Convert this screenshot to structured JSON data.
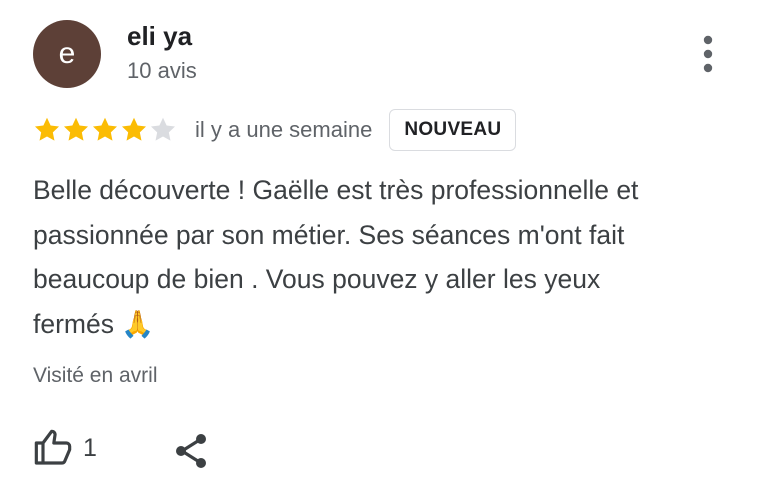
{
  "reviewer": {
    "avatar_letter": "e",
    "name": "eli ya",
    "review_count": "10 avis"
  },
  "rating": {
    "value": 4,
    "max": 5
  },
  "date": "il y a une semaine",
  "badge": "NOUVEAU",
  "review": {
    "line1": "Belle découverte ! Gaëlle est très professionnelle et",
    "line2": "passionnée par son métier. Ses séances m'ont fait",
    "line3": "beaucoup de bien . Vous pouvez y aller les yeux",
    "line4": "fermés",
    "emoji": "🙏"
  },
  "visited": "Visité en avril",
  "actions": {
    "like_count": "1"
  },
  "icons": {
    "menu": "more-vert-icon",
    "like": "thumb-up-outline-icon",
    "share": "share-icon"
  },
  "colors": {
    "avatar_bg": "#5d4037",
    "star_filled": "#fbbc04",
    "star_empty": "#dadce0",
    "text": "#3c4043",
    "muted": "#5f6368"
  }
}
